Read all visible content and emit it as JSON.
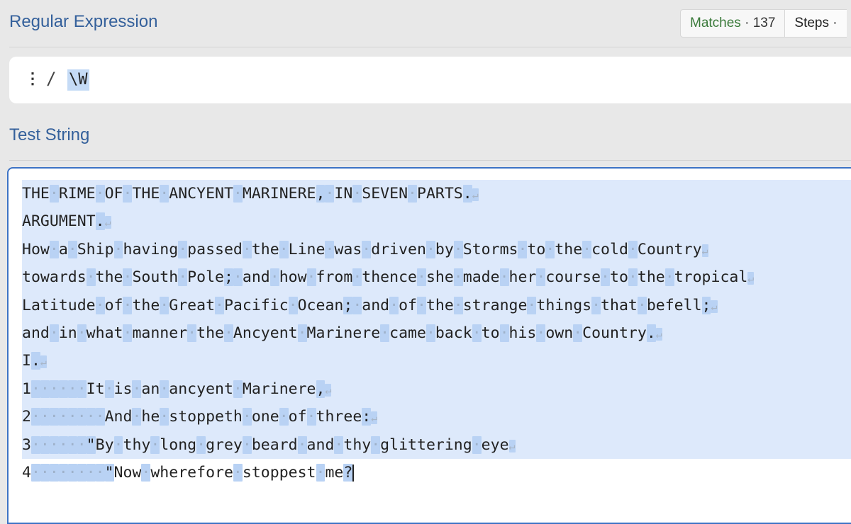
{
  "regex_section": {
    "title": "Regular Expression",
    "matches_label": "Matches",
    "matches_value": "· 137",
    "steps_label": "Steps ·",
    "menu_icon": "vertical-ellipsis-icon",
    "delimiter": "/",
    "pattern": "\\W"
  },
  "test_section": {
    "title": "Test String",
    "lines": [
      "THE RIME OF THE ANCYENT MARINERE, IN SEVEN PARTS.",
      "ARGUMENT.",
      "How a Ship having passed the Line was driven by Storms to the cold Country",
      "towards the South Pole; and how from thence she made her course to the tropical",
      "Latitude of the Great Pacific Ocean; and of the strange things that befell;",
      "and in what manner the Ancyent Marinere came back to his own Country.",
      "I.",
      "1      It is an ancyent Marinere,",
      "2        And he stoppeth one of three:",
      "3      \"By thy long grey beard and thy glittering eye",
      "4        \"Now wherefore stoppest me?"
    ]
  }
}
